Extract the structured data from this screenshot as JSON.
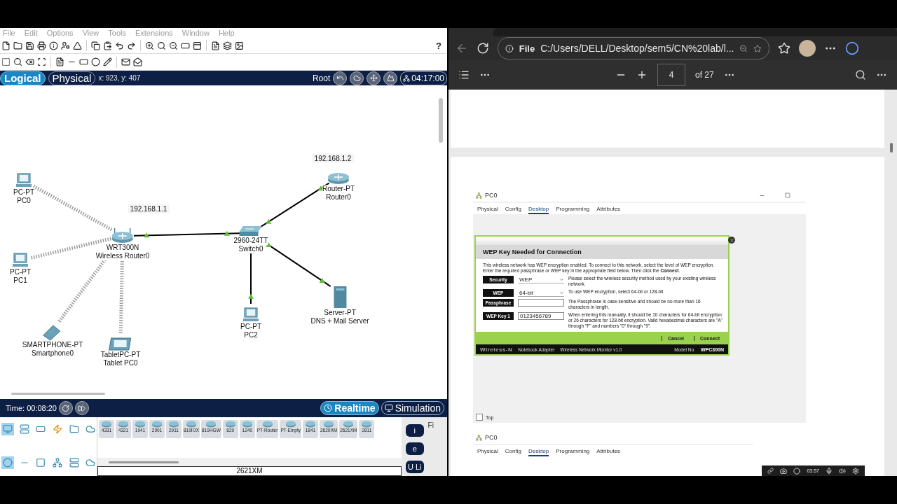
{
  "packet_tracer": {
    "menu": [
      "File",
      "Edit",
      "Options",
      "View",
      "Tools",
      "Extensions",
      "Window",
      "Help"
    ],
    "help": "?",
    "view_tabs": [
      {
        "label": "Logical",
        "selected": true
      },
      {
        "label": "Physical",
        "selected": false
      }
    ],
    "coordinates": "x: 923, y: 407",
    "root": "Root",
    "clock": "04:17:00",
    "topology": {
      "nodes": [
        {
          "kind": "router",
          "model": "Router-PT",
          "name": "Router0",
          "address": "192.168.1.2"
        },
        {
          "kind": "pc",
          "model": "PC-PT",
          "name": "PC0"
        },
        {
          "kind": "wireless_router",
          "model": "WRT300N",
          "name": "Wireless Router0",
          "address": "192.168.1.1"
        },
        {
          "kind": "switch",
          "model": "2960-24TT",
          "name": "Switch0"
        },
        {
          "kind": "pc",
          "model": "PC-PT",
          "name": "PC1"
        },
        {
          "kind": "server",
          "model": "Server-PT",
          "name": "DNS + Mail Server"
        },
        {
          "kind": "pc",
          "model": "PC-PT",
          "name": "PC2"
        },
        {
          "kind": "smartphone",
          "model": "SMARTPHONE-PT",
          "name": "Smartphone0"
        },
        {
          "kind": "tablet",
          "model": "TabletPC-PT",
          "name": "Tablet PC0"
        }
      ],
      "links": [
        {
          "kind": "wireless"
        },
        {
          "kind": "wireless"
        },
        {
          "kind": "wireless"
        },
        {
          "kind": "wireless"
        },
        {
          "kind": "wired"
        },
        {
          "kind": "wired"
        },
        {
          "kind": "wired"
        },
        {
          "kind": "wired"
        }
      ]
    },
    "time": "Time: 00:08:20",
    "modes": [
      {
        "label": "Realtime",
        "selected": true
      },
      {
        "label": "Simulation",
        "selected": false
      }
    ],
    "device_models": [
      "4331",
      "4321",
      "1941",
      "2901",
      "2911",
      "819IOX",
      "819HGW",
      "829",
      "1240",
      "PT-Router",
      "PT-Empty",
      "1841",
      "2620XM",
      "2621XM",
      "2811"
    ],
    "selected_model": "2621XM",
    "side_buttons": [
      "i",
      "e",
      "U Li"
    ],
    "side_label": "Fi"
  },
  "browser": {
    "url_scheme": "File",
    "url": "C:/Users/DELL/Desktop/sem5/CN%20lab/l...",
    "page": "4",
    "page_count": "of 27",
    "document": {
      "window_title": "PC0",
      "tabs": [
        {
          "label": "Physical",
          "selected": false
        },
        {
          "label": "Config",
          "selected": false
        },
        {
          "label": "Desktop",
          "selected": true
        },
        {
          "label": "Programming",
          "selected": false
        },
        {
          "label": "Attributes",
          "selected": false
        }
      ],
      "dialog": {
        "title": "WEP Key Needed for Connection",
        "intro": "This wireless network has WEP encryption enabled. To connect to this network, select the level of WEP encryption. Enter the required passphrase or WEP key in the appropriate field below. Then click the **Connect**.",
        "fields": [
          {
            "label": "Security",
            "kind": "select",
            "value": "WEP",
            "help": "Please select the wireless security method used by your existing wireless network."
          },
          {
            "label": "WEP",
            "kind": "select",
            "value": "64-bit",
            "help": "To use WEP encryption, select 64-bit or 128-bit"
          },
          {
            "label": "Passphrase",
            "kind": "text",
            "help": "The Passphrase is case-sensitive and should be no more than 16 characters in length."
          },
          {
            "label": "WEP Key 1",
            "kind": "text",
            "value": "0123456789",
            "help": "When entering this manually, it should be 10 characters for 64-bit encryption or 26 characters for 128-bit encryption. Valid hexadecimal characters are \"A\" through \"F\" and numbers \"0\" through \"9\"."
          }
        ],
        "buttons": [
          "Cancel",
          "Connect"
        ],
        "footer": {
          "brand": "Wireless-N",
          "product": "Notebook Adapter",
          "app": "Wireless Network Monitor v1.0",
          "model_caption": "Model No.",
          "model": "WPC300N"
        }
      },
      "top_checkbox": {
        "label": "Top",
        "checked": false
      },
      "second_window": {
        "title": "PC0",
        "tabs": [
          {
            "label": "Physical",
            "selected": false
          },
          {
            "label": "Config",
            "selected": false
          },
          {
            "label": "Desktop",
            "selected": true
          },
          {
            "label": "Programming",
            "selected": false
          },
          {
            "label": "Attributes",
            "selected": false
          }
        ]
      }
    },
    "recorder_time": "03:57"
  }
}
